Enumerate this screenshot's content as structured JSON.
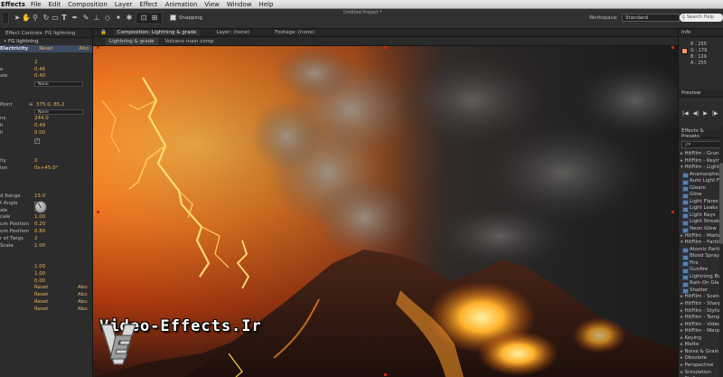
{
  "menubar": {
    "app": "Effects",
    "items": [
      "File",
      "Edit",
      "Composition",
      "Layer",
      "Effect",
      "Animation",
      "View",
      "Window",
      "Help"
    ]
  },
  "toolbar": {
    "snapping_label": "Snapping",
    "project_title": "Untitled Project *",
    "workspace_label": "Workspace:",
    "workspace_value": "Standard",
    "search_placeholder": "Search Help"
  },
  "effect_controls": {
    "tab": "Effect Controls: FG lightning",
    "layer": "• FG lightning",
    "effect_name": "Electricity",
    "reset": "Reset",
    "about": "Abo",
    "params": [
      {
        "label": "",
        "value": ""
      },
      {
        "label": "",
        "value": "2"
      },
      {
        "label": "e",
        "value": "0.46"
      },
      {
        "label": "ale",
        "value": "0.40"
      },
      {
        "label": "",
        "dropdown": "None"
      },
      {
        "label": "",
        "value": ""
      },
      {
        "label": "",
        "value": ""
      },
      {
        "label": "Point",
        "point": "375.0, 85.2"
      },
      {
        "label": "",
        "dropdown": "None"
      },
      {
        "label": "ns",
        "value": "244.0"
      },
      {
        "label": "h",
        "value": "0.49"
      },
      {
        "label": "h",
        "value": "0.00"
      },
      {
        "label": "",
        "checkbox": "✓"
      },
      {
        "label": "",
        "value": ""
      },
      {
        "label": "",
        "value": ""
      },
      {
        "label": "ity",
        "value": "2"
      },
      {
        "label": "ion",
        "value": "0x+45.0°"
      },
      {
        "label": "",
        "value": ""
      },
      {
        "label": "",
        "value": ""
      },
      {
        "label": "",
        "value": ""
      },
      {
        "label": "d Range",
        "value": "15.0"
      },
      {
        "label": "t Angle",
        "checkbox": "✓"
      },
      {
        "label": "ale",
        "value": "0.00"
      },
      {
        "label": "cale",
        "value": "1.00"
      },
      {
        "label": "um Position",
        "value": "0.20"
      },
      {
        "label": "um Position",
        "value": "0.80"
      },
      {
        "label": "r of Twigs",
        "value": "2"
      },
      {
        "label": "Scale",
        "value": "1.00"
      },
      {
        "label": "",
        "value": ""
      },
      {
        "label": "",
        "value": ""
      },
      {
        "label": "",
        "value": "1.00"
      },
      {
        "label": "",
        "value": "1.00"
      },
      {
        "label": "",
        "value": "0.00"
      },
      {
        "label": "",
        "reset": "Reset",
        "about": "Abo"
      },
      {
        "label": "",
        "reset": "Reset",
        "about": "Abo"
      },
      {
        "label": "",
        "reset": "Reset",
        "about": "Abo"
      },
      {
        "label": "",
        "reset": "Reset",
        "about": "Abo"
      }
    ]
  },
  "composition": {
    "tab": "Composition: Lightning & grade",
    "layer_tab": "Layer: (none)",
    "footage_tab": "Footage: (none)",
    "crumb_active": "Lightning & grade",
    "crumb_other": "Volcano main comp"
  },
  "watermark": {
    "text": "Video-Effects.Ir"
  },
  "info_panel": {
    "tab": "Info",
    "tab2": "",
    "r": "R : 255",
    "g": "G : 179",
    "b": "B : 129",
    "a": "A : 255",
    "swatch_color": "#ff9a5d"
  },
  "preview_panel": {
    "tab": "Preview",
    "buttons": [
      "|◀",
      "◀|",
      "▶",
      "|▶",
      "▶|"
    ]
  },
  "effects_presets": {
    "tab": "Effects & Presets",
    "search": "",
    "items": [
      {
        "type": "cat",
        "label": "HitFilm - Grunge"
      },
      {
        "type": "cat",
        "label": "HitFilm - Keying"
      },
      {
        "type": "cat",
        "open": true,
        "label": "HitFilm - Lights & Flares"
      },
      {
        "type": "it",
        "label": "Anamorphic Lens Flare"
      },
      {
        "type": "it",
        "label": "Auto Light Flares"
      },
      {
        "type": "it",
        "label": "Gleam"
      },
      {
        "type": "it",
        "label": "Glow"
      },
      {
        "type": "it",
        "label": "Light Flares"
      },
      {
        "type": "it",
        "label": "Light Leaks"
      },
      {
        "type": "it",
        "label": "Light Rays"
      },
      {
        "type": "it",
        "label": "Light Streaks"
      },
      {
        "type": "it",
        "label": "Neon Glow"
      },
      {
        "type": "cat",
        "label": "HitFilm - Matte Enhance"
      },
      {
        "type": "cat",
        "open": true,
        "label": "HitFilm - Particles"
      },
      {
        "type": "it",
        "label": "Atomic Particles"
      },
      {
        "type": "it",
        "label": "Blood Spray"
      },
      {
        "type": "it",
        "label": "Fire"
      },
      {
        "type": "it",
        "label": "Gunfire"
      },
      {
        "type": "it",
        "label": "Lightning Bolts"
      },
      {
        "type": "it",
        "label": "Rain On Glass"
      },
      {
        "type": "it",
        "label": "Shatter"
      },
      {
        "type": "cat",
        "label": "HitFilm - Scene"
      },
      {
        "type": "cat",
        "label": "HitFilm - Sharpen"
      },
      {
        "type": "cat",
        "label": "HitFilm - Stylize"
      },
      {
        "type": "cat",
        "label": "HitFilm - Temporal"
      },
      {
        "type": "cat",
        "label": "HitFilm - Video Clean-up"
      },
      {
        "type": "cat",
        "label": "HitFilm - Warp"
      },
      {
        "type": "cat",
        "label": "Keying"
      },
      {
        "type": "cat",
        "label": "Matte"
      },
      {
        "type": "cat",
        "label": "Noise & Grain"
      },
      {
        "type": "cat",
        "label": "Obsolete"
      },
      {
        "type": "cat",
        "label": "Perspective"
      },
      {
        "type": "cat",
        "label": "Simulation"
      },
      {
        "type": "cat",
        "label": "Stylize"
      },
      {
        "type": "cat",
        "label": "Synthetic Aperture"
      }
    ]
  }
}
